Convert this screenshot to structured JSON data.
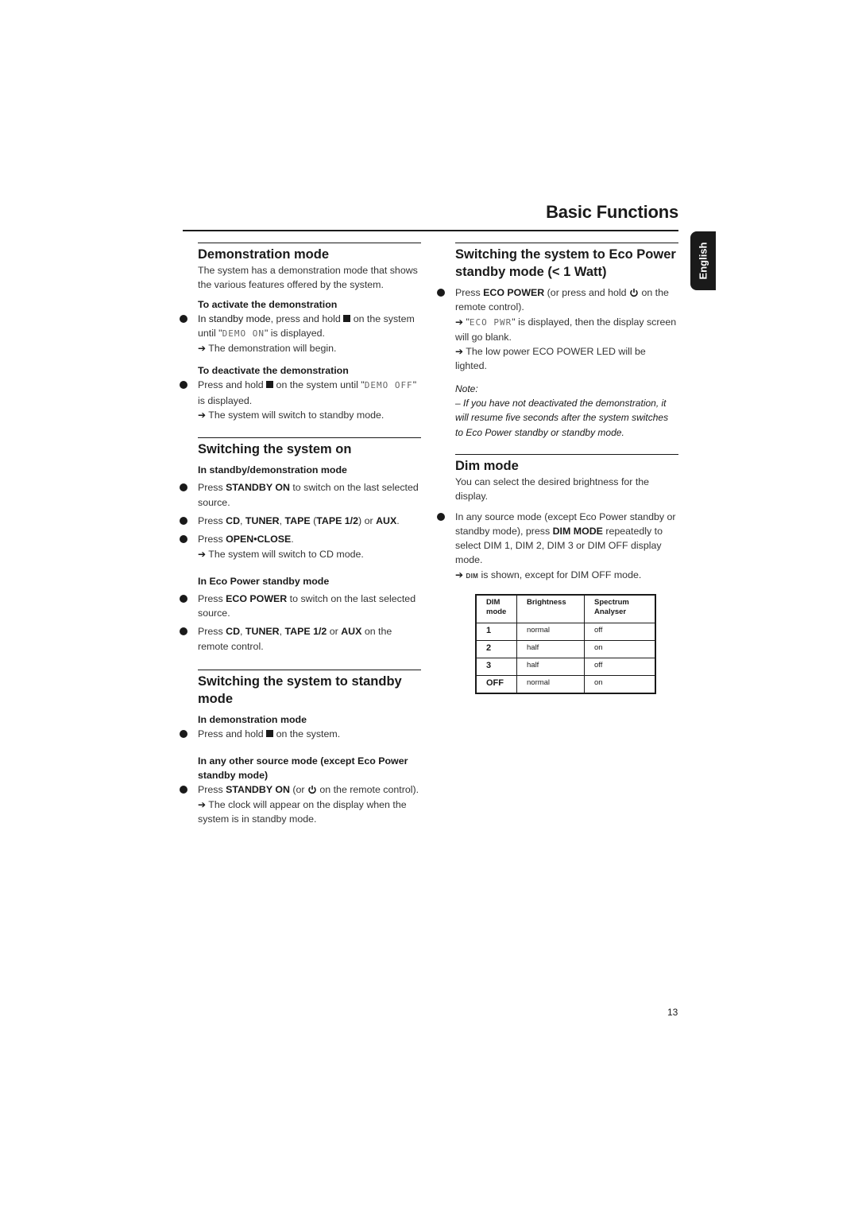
{
  "header": {
    "title": "Basic Functions",
    "language_tab": "English"
  },
  "left_column": {
    "demo": {
      "heading": "Demonstration mode",
      "intro": "The system has a demonstration mode that shows the various features offered by the system.",
      "activate_heading": "To activate the demonstration",
      "activate_pre": "In standby mode",
      "activate_mid": ", press and hold ",
      "activate_post1": " on the system until \"",
      "activate_lcd": "DEMO ON",
      "activate_post2": "\" is displayed.",
      "activate_result": "The demonstration will begin.",
      "deactivate_heading": "To deactivate the demonstration",
      "deactivate_pre": "Press and hold ",
      "deactivate_post1": " on the system until \"",
      "deactivate_lcd": "DEMO OFF",
      "deactivate_post2": "\" is displayed.",
      "deactivate_result": "The system will switch to standby mode."
    },
    "switch_on": {
      "heading": "Switching the system on",
      "sub1": "In standby/demonstration mode",
      "b1_pre": "Press ",
      "b1_key": "STANDBY ON",
      "b1_post": " to switch on the last selected source.",
      "b2_pre": "Press ",
      "b2_k1": "CD",
      "b2_k2": "TUNER",
      "b2_k3": "TAPE",
      "b2_k4": "TAPE 1/2",
      "b2_or": " or ",
      "b2_k5": "AUX",
      "b3_pre": "Press ",
      "b3_key": "OPEN•CLOSE",
      "b3_result": "The system will switch to CD mode.",
      "sub2": "In Eco Power standby mode",
      "b4_pre": "Press ",
      "b4_key": "ECO POWER",
      "b4_post": " to switch on the last selected source.",
      "b5_pre": "Press ",
      "b5_k1": "CD",
      "b5_k2": "TUNER",
      "b5_k3": "TAPE 1/2",
      "b5_or": " or ",
      "b5_k4": "AUX",
      "b5_post": " on the remote control."
    },
    "standby": {
      "heading": "Switching the system to standby mode",
      "sub1": "In demonstration mode",
      "b1_pre": "Press and hold ",
      "b1_post": " on the system.",
      "sub2": "In any other source mode (except Eco Power standby mode)",
      "b2_pre": "Press ",
      "b2_key": "STANDBY ON",
      "b2_mid": " (or ",
      "b2_post": " on the remote control).",
      "b2_result": "The clock will appear on the display when the system is in standby mode."
    }
  },
  "right_column": {
    "eco": {
      "heading": "Switching the system to Eco Power standby mode (< 1 Watt)",
      "b1_pre": "Press ",
      "b1_key": "ECO POWER",
      "b1_mid": " (or press and hold ",
      "b1_post": " on the remote control).",
      "r1_pre": "\"",
      "r1_lcd": "ECO PWR",
      "r1_post": "\" is displayed, then the display screen will go blank.",
      "r2": "The low power ECO POWER LED will be lighted.",
      "note_label": "Note:",
      "note_text": "–  If you have not deactivated the demonstration, it will resume five seconds after the system switches to Eco Power standby or standby mode."
    },
    "dim": {
      "heading": "Dim mode",
      "intro": "You can select the desired brightness for the display.",
      "b1_pre": "In any source mode (except Eco Power standby or standby mode), press ",
      "b1_key": "DIM MODE",
      "b1_post": " repeatedly to select DIM 1, DIM 2, DIM 3 or DIM OFF display mode.",
      "r1_icon": "DIM",
      "r1_post": " is shown, except for DIM OFF mode.",
      "table": {
        "headers": [
          "DIM mode",
          "Brightness",
          "Spectrum Analyser"
        ],
        "rows": [
          [
            "1",
            "normal",
            "off"
          ],
          [
            "2",
            "half",
            "on"
          ],
          [
            "3",
            "half",
            "off"
          ],
          [
            "OFF",
            "normal",
            "on"
          ]
        ]
      }
    }
  },
  "icons": {
    "stop": "stop-icon",
    "power": "power-icon",
    "arrow": "➔"
  },
  "footer": {
    "page_number": "13"
  }
}
